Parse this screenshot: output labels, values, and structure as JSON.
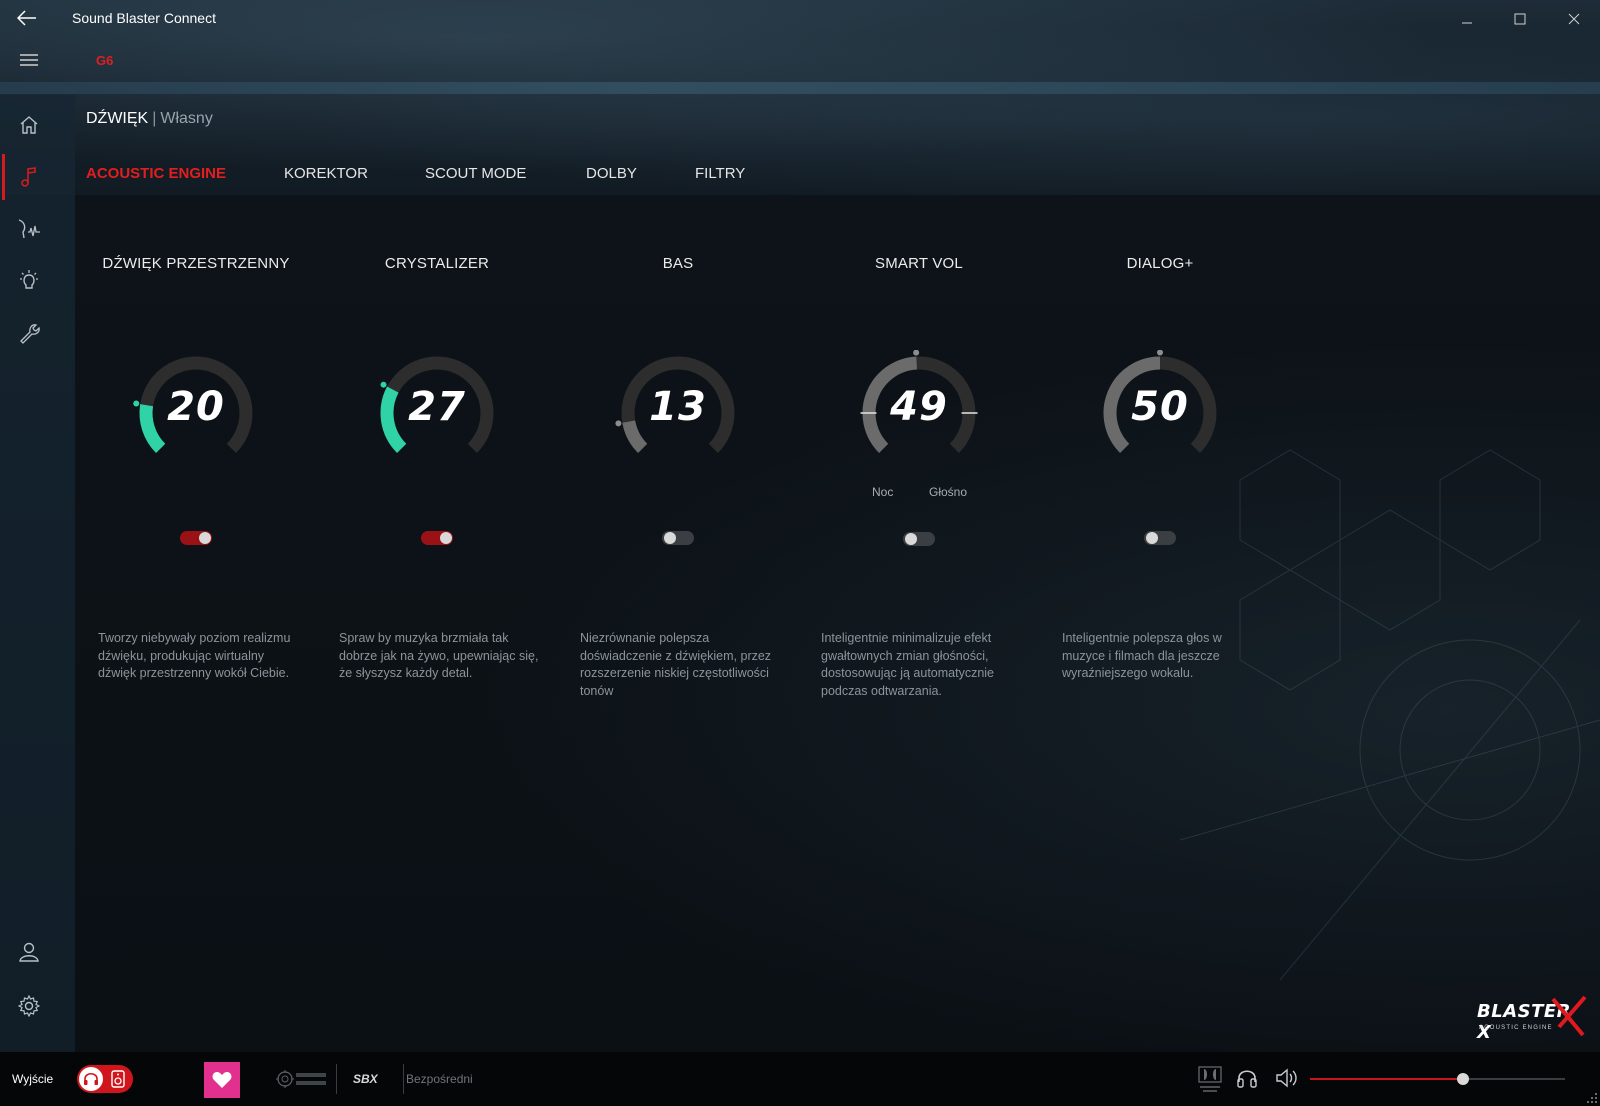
{
  "app": {
    "title": "Sound Blaster Connect",
    "device": "G6"
  },
  "header": {
    "section": "DŹWIĘK",
    "separator": "|",
    "preset": "Własny"
  },
  "tabs": [
    {
      "label": "ACOUSTIC ENGINE",
      "active": true
    },
    {
      "label": "KOREKTOR",
      "active": false
    },
    {
      "label": "SCOUT MODE",
      "active": false
    },
    {
      "label": "DOLBY",
      "active": false
    },
    {
      "label": "FILTRY",
      "active": false
    }
  ],
  "sidebar": {
    "items": [
      {
        "icon": "home-icon"
      },
      {
        "icon": "music-note-icon",
        "active": true
      },
      {
        "icon": "voice-wave-icon"
      },
      {
        "icon": "lightbulb-icon"
      },
      {
        "icon": "wrench-icon"
      },
      {
        "icon": "user-icon"
      },
      {
        "icon": "gear-icon"
      }
    ]
  },
  "modules": [
    {
      "title": "DŹWIĘK PRZESTRZENNY",
      "value": "20",
      "level": 20,
      "enabled": true,
      "bipolar": false,
      "description": "Tworzy niebywały poziom realizmu dźwięku, produkując wirtualny dźwięk przestrzenny wokół Ciebie."
    },
    {
      "title": "CRYSTALIZER",
      "value": "27",
      "level": 27,
      "enabled": true,
      "bipolar": false,
      "description": "Spraw by muzyka brzmiała tak dobrze jak na żywo, upewniając się, że słyszysz każdy detal."
    },
    {
      "title": "BAS",
      "value": "13",
      "level": 13,
      "enabled": false,
      "bipolar": false,
      "description": "Niezrównanie polepsza doświadczenie z dźwiękiem, przez rozszerzenie niskiej częstotliwości tonów"
    },
    {
      "title": "SMART VOL",
      "value": "49",
      "level": 49,
      "enabled": false,
      "bipolar": false,
      "has_markers": true,
      "label_left": "Noc",
      "label_right": "Głośno",
      "description": "Inteligentnie minimalizuje efekt gwałtownych zmian głośności, dostosowując ją automatycznie podczas odtwarzania."
    },
    {
      "title": "DIALOG+",
      "value": "50",
      "level": 50,
      "enabled": false,
      "bipolar": false,
      "description": "Inteligentnie polepsza głos w muzyce i filmach dla jeszcze wyraźniejszego wokalu."
    }
  ],
  "logo": {
    "brand": "BLASTER X",
    "tagline": "ACOUSTIC ENGINE"
  },
  "bottom": {
    "output_label": "Wyjście",
    "sbx_label": "SBX",
    "direct_label": "Bezpośredni",
    "volume_percent": 60
  },
  "colors": {
    "accent_red": "#d11d1d",
    "dial_active": "#2fd3a5",
    "dial_inactive_fill": "#6b6b6b",
    "dial_track": "#2d2d2d",
    "favorite_pink": "#e2308f"
  }
}
